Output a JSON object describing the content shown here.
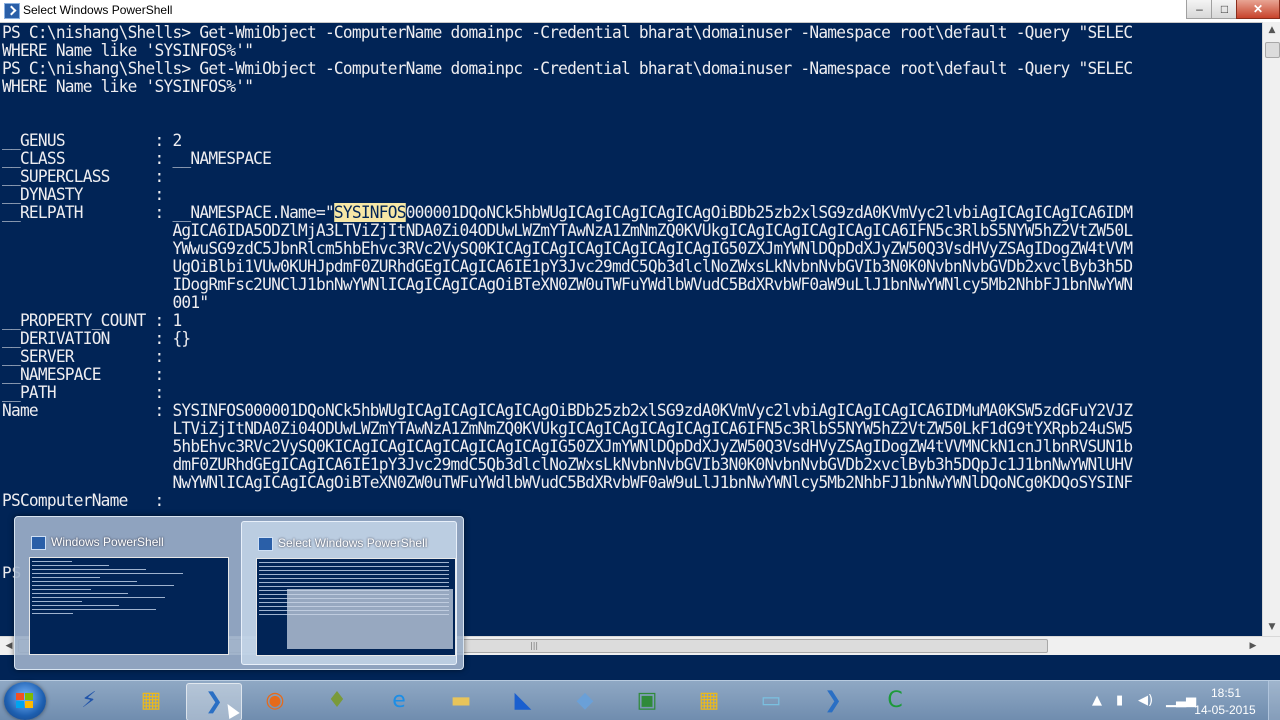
{
  "window": {
    "title": "Select Windows PowerShell",
    "controls": {
      "minimize": "–",
      "maximize": "□",
      "close": "✕"
    }
  },
  "console": {
    "lines": [
      "PS C:\\nishang\\Shells> Get-WmiObject -ComputerName domainpc -Credential bharat\\domainuser -Namespace root\\default -Query \"SELEC",
      "WHERE Name like 'SYSINFOS%'\"",
      "PS C:\\nishang\\Shells> Get-WmiObject -ComputerName domainpc -Credential bharat\\domainuser -Namespace root\\default -Query \"SELEC",
      "WHERE Name like 'SYSINFOS%'\"",
      "",
      "",
      "__GENUS          : 2",
      "__CLASS          : __NAMESPACE",
      "__SUPERCLASS     :",
      "__DYNASTY        :",
      "__RELPATH        : __NAMESPACE.Name=\"",
      "                   AgICA6IDA5ODZlMjA3LTViZjItNDA0Zi04ODUwLWZmYTAwNzA1ZmNmZQ0KVUkgICAgICAgICAgICAgICA6IFN5c3RlbS5NYW5hZ2VtZW50L",
      "                   YWwuSG9zdC5JbnRlcm5hbEhvc3RVc2VySQ0KICAgICAgICAgICAgICAgICAgIG50ZXJmYWNlDQpDdXJyZW50Q3VsdHVyZSAgIDogZW4tVVM",
      "                   UgOiBlbi1VUw0KUHJpdmF0ZURhdGEgICAgICA6IE1pY3Jvc29mdC5Qb3dlclNoZWxsLkNvbnNvbGVIb3N0K0NvbnNvbGVDb2xvclByb3h5D",
      "                   IDogRmFsc2UNClJ1bnNwYWNlICAgICAgICAgOiBTeXN0ZW0uTWFuYWdlbWVudC5BdXRvbWF0aW9uLlJ1bnNwYWNlcy5Mb2NhbFJ1bnNwYWN",
      "                   001\"",
      "__PROPERTY_COUNT : 1",
      "__DERIVATION     : {}",
      "__SERVER         :",
      "__NAMESPACE      :",
      "__PATH           :",
      "Name             : SYSINFOS000001DQoNCk5hbWUgICAgICAgICAgICAgOiBDb25zb2xlSG9zdA0KVmVyc2lvbiAgICAgICAgICA6IDMuMA0KSW5zdGFuY2VJZ",
      "                   LTViZjItNDA0Zi04ODUwLWZmYTAwNzA1ZmNmZQ0KVUkgICAgICAgICAgICAgICA6IFN5c3RlbS5NYW5hZ2VtZW50LkF1dG9tYXRpb24uSW5",
      "                   5hbEhvc3RVc2VySQ0KICAgICAgICAgICAgICAgICAgIG50ZXJmYWNlDQpDdXJyZW50Q3VsdHVyZSAgIDogZW4tVVMNCkN1cnJlbnRVSUN1b",
      "                   dmF0ZURhdGEgICAgICA6IE1pY3Jvc29mdC5Qb3dlclNoZWxsLkNvbnNvbGVIb3N0K0NvbnNvbGVDb2xvclByb3h5DQpJc1J1bnNwYWNlUHV",
      "                   NwYWNlICAgICAgICAgOiBTeXN0ZW0uTWFuYWdlbWVudC5BdXRvbWF0aW9uLlJ1bnNwYWNlcy5Mb2NhbFJ1bnNwYWNlDQoNCg0KDQoSYSINF",
      "PSComputerName   :"
    ],
    "relpath_highlight": "SYSINFOS",
    "relpath_after_highlight": "000001DQoNCk5hbWUgICAgICAgICAgICAgOiBDb25zb2xlSG9zdA0KVmVyc2lvbiAgICAgICAgICA6IDM",
    "hidden_prompt": "PS"
  },
  "taskbar_preview": {
    "cards": [
      {
        "label": "Windows PowerShell",
        "active": false
      },
      {
        "label": "Select Windows PowerShell",
        "active": true
      }
    ]
  },
  "taskbar": {
    "items": [
      {
        "name": "network-tool-icon",
        "glyph": "⚡",
        "color": "#2255aa"
      },
      {
        "name": "virtualbox-icon",
        "glyph": "▦",
        "color": "#e8b820"
      },
      {
        "name": "powershell-icon",
        "glyph": "❯",
        "color": "#2a6fc4"
      },
      {
        "name": "firefox-icon",
        "glyph": "◉",
        "color": "#e66a1a"
      },
      {
        "name": "onion-icon",
        "glyph": "♦",
        "color": "#7a9a3a"
      },
      {
        "name": "ie-icon",
        "glyph": "e",
        "color": "#1c8ee6"
      },
      {
        "name": "folder-icon",
        "glyph": "▬",
        "color": "#e8c45a"
      },
      {
        "name": "shark-icon",
        "glyph": "◣",
        "color": "#1a5fcf"
      },
      {
        "name": "cube-icon",
        "glyph": "◆",
        "color": "#6aa0d8"
      },
      {
        "name": "terminal-icon",
        "glyph": "▣",
        "color": "#2f8a3a"
      },
      {
        "name": "virtualbox-icon-2",
        "glyph": "▦",
        "color": "#e8b820"
      },
      {
        "name": "notepad-icon",
        "glyph": "▭",
        "color": "#7ac0e0"
      },
      {
        "name": "powershell-icon-2",
        "glyph": "❯",
        "color": "#2a6fc4"
      },
      {
        "name": "camtasia-icon",
        "glyph": "C",
        "color": "#1d9a3a"
      }
    ],
    "active_index": 2
  },
  "tray": {
    "time": "18:51",
    "date": "14-05-2015"
  }
}
